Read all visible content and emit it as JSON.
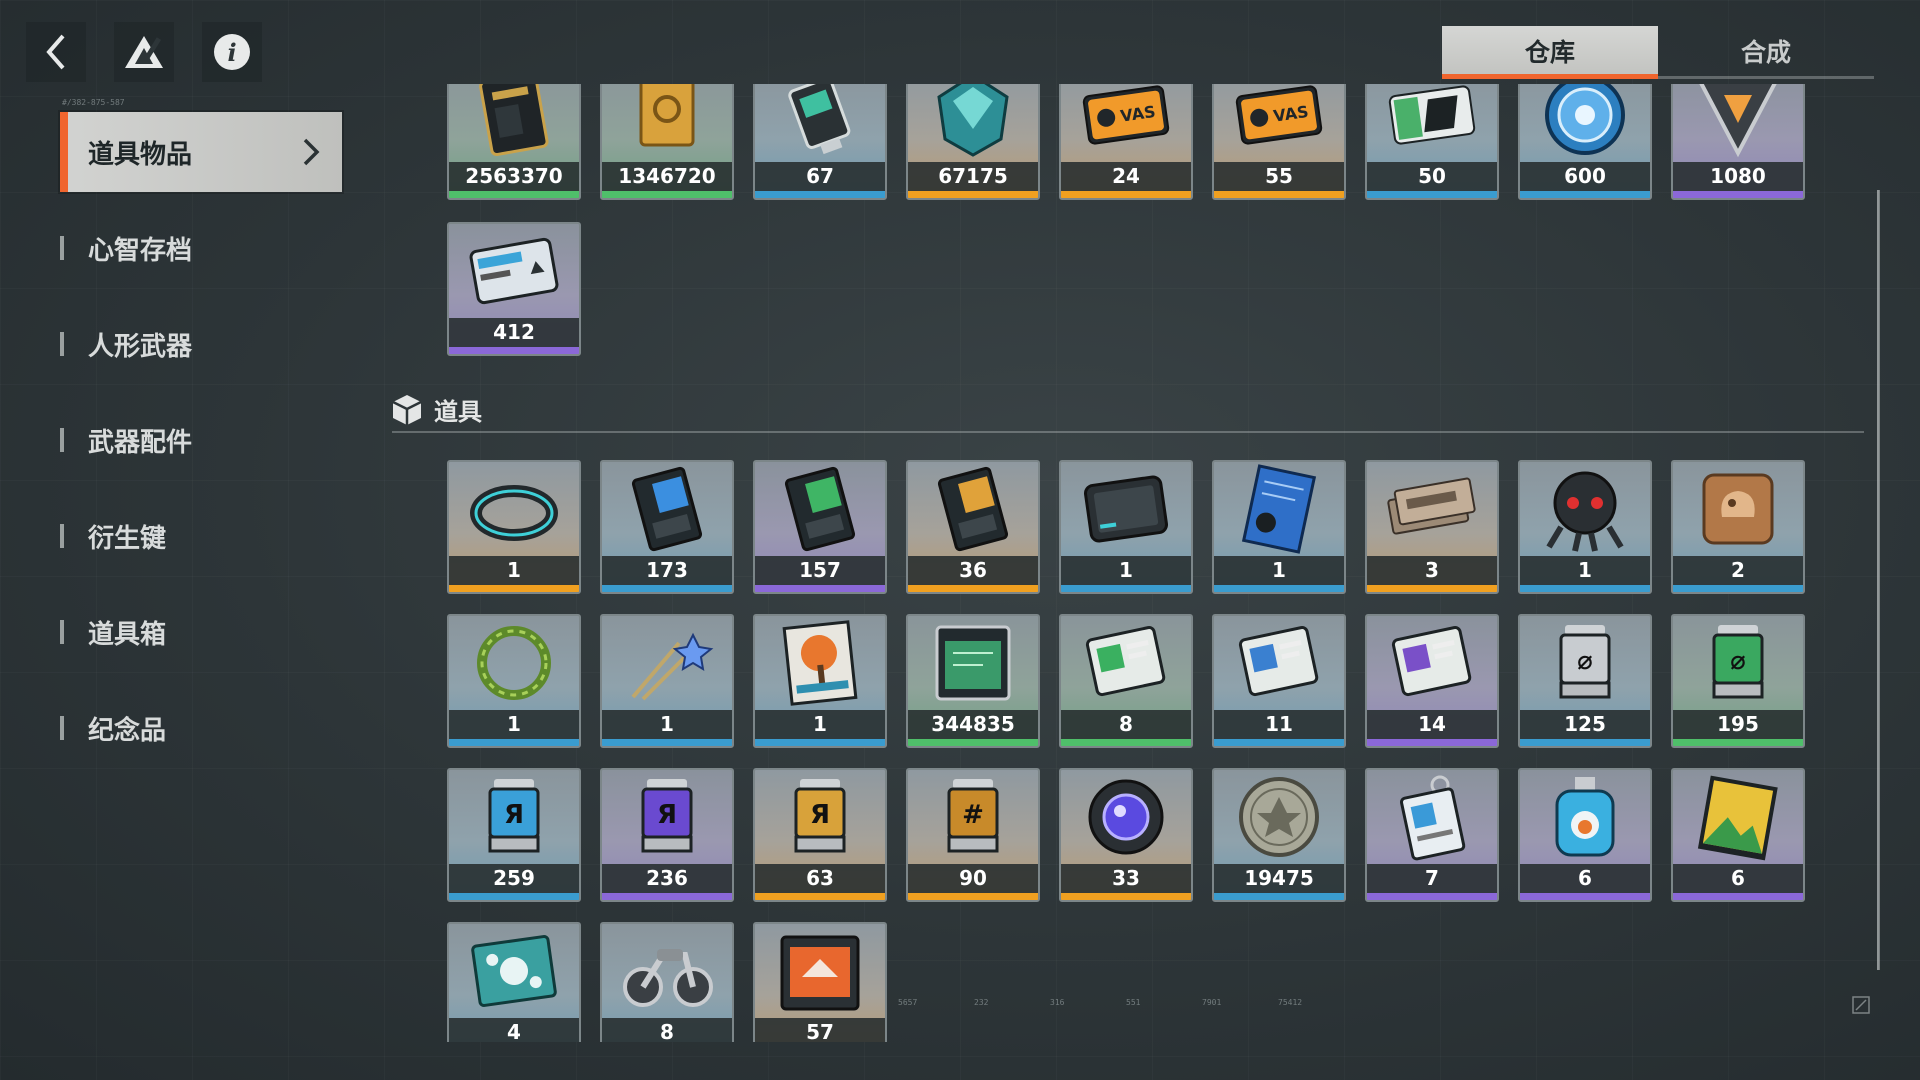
{
  "tabs": [
    {
      "label": "仓库",
      "active": true
    },
    {
      "label": "合成",
      "active": false
    }
  ],
  "sidebar": {
    "items": [
      {
        "label": "道具物品",
        "active": true
      },
      {
        "label": "心智存档",
        "active": false
      },
      {
        "label": "人形武器",
        "active": false
      },
      {
        "label": "武器配件",
        "active": false
      },
      {
        "label": "衍生键",
        "active": false
      },
      {
        "label": "道具箱",
        "active": false
      },
      {
        "label": "纪念品",
        "active": false
      }
    ]
  },
  "decor_text": {
    "sidebar_code": "#/382-875-587",
    "footer_nums": [
      "5657",
      "232",
      "316",
      "551",
      "7901",
      "75412"
    ]
  },
  "section": {
    "label": "道具",
    "icon": "cube-icon"
  },
  "colors": {
    "accent": "#f0652e",
    "orange": "#f0a020",
    "blue": "#3a9ccf",
    "purple": "#8b68d8",
    "green": "#4fbf6a"
  },
  "currency_rows": [
    [
      {
        "count": "2563370",
        "icon": "black-card-icon",
        "rarity": "green"
      },
      {
        "count": "1346720",
        "icon": "gold-bar-icon",
        "rarity": "green"
      },
      {
        "count": "67",
        "icon": "usb-drive-icon",
        "rarity": "blue"
      },
      {
        "count": "67175",
        "icon": "crystal-icon",
        "rarity": "orange"
      },
      {
        "count": "24",
        "icon": "orange-ticket-icon",
        "rarity": "orange"
      },
      {
        "count": "55",
        "icon": "orange-ticket-icon",
        "rarity": "orange"
      },
      {
        "count": "50",
        "icon": "green-ticket-icon",
        "rarity": "blue"
      },
      {
        "count": "600",
        "icon": "blue-coin-icon",
        "rarity": "blue"
      },
      {
        "count": "1080",
        "icon": "triangle-chip-icon",
        "rarity": "purple"
      }
    ],
    [
      {
        "count": "412",
        "icon": "id-card-icon",
        "rarity": "purple"
      }
    ]
  ],
  "item_rows": [
    [
      {
        "count": "1",
        "icon": "bracelet-icon",
        "rarity": "orange"
      },
      {
        "count": "173",
        "icon": "blue-chip-icon",
        "rarity": "blue"
      },
      {
        "count": "157",
        "icon": "green-chip-icon",
        "rarity": "purple"
      },
      {
        "count": "36",
        "icon": "gold-chip-icon",
        "rarity": "orange"
      },
      {
        "count": "1",
        "icon": "tablet-icon",
        "rarity": "blue"
      },
      {
        "count": "1",
        "icon": "blueprint-icon",
        "rarity": "blue"
      },
      {
        "count": "3",
        "icon": "tickets-icon",
        "rarity": "orange"
      },
      {
        "count": "1",
        "icon": "robot-icon",
        "rarity": "blue"
      },
      {
        "count": "2",
        "icon": "cookie-mold-icon",
        "rarity": "blue"
      }
    ],
    [
      {
        "count": "1",
        "icon": "wreath-icon",
        "rarity": "blue"
      },
      {
        "count": "1",
        "icon": "hairpin-icon",
        "rarity": "blue"
      },
      {
        "count": "1",
        "icon": "painting-icon",
        "rarity": "blue"
      },
      {
        "count": "344835",
        "icon": "schematic-icon",
        "rarity": "green"
      },
      {
        "count": "8",
        "icon": "green-card-icon",
        "rarity": "green"
      },
      {
        "count": "11",
        "icon": "blue-card-icon",
        "rarity": "blue"
      },
      {
        "count": "14",
        "icon": "purple-card-icon",
        "rarity": "purple"
      },
      {
        "count": "125",
        "icon": "canister-icon",
        "rarity": "blue"
      },
      {
        "count": "195",
        "icon": "green-canister-icon",
        "rarity": "green"
      }
    ],
    [
      {
        "count": "259",
        "icon": "blue-canister-icon",
        "rarity": "blue"
      },
      {
        "count": "236",
        "icon": "purple-canister-icon",
        "rarity": "purple"
      },
      {
        "count": "63",
        "icon": "gold-canister-icon",
        "rarity": "orange"
      },
      {
        "count": "90",
        "icon": "amber-canister-icon",
        "rarity": "orange"
      },
      {
        "count": "33",
        "icon": "orb-icon",
        "rarity": "orange"
      },
      {
        "count": "19475",
        "icon": "medal-icon",
        "rarity": "blue"
      },
      {
        "count": "7",
        "icon": "keychain-icon",
        "rarity": "purple"
      },
      {
        "count": "6",
        "icon": "bottle-icon",
        "rarity": "purple"
      },
      {
        "count": "6",
        "icon": "photo-icon",
        "rarity": "purple"
      }
    ],
    [
      {
        "count": "4",
        "icon": "snowflake-tile-icon",
        "rarity": "blue"
      },
      {
        "count": "8",
        "icon": "motorcycle-icon",
        "rarity": "blue"
      },
      {
        "count": "57",
        "icon": "orange-crate-icon",
        "rarity": "orange"
      }
    ]
  ]
}
